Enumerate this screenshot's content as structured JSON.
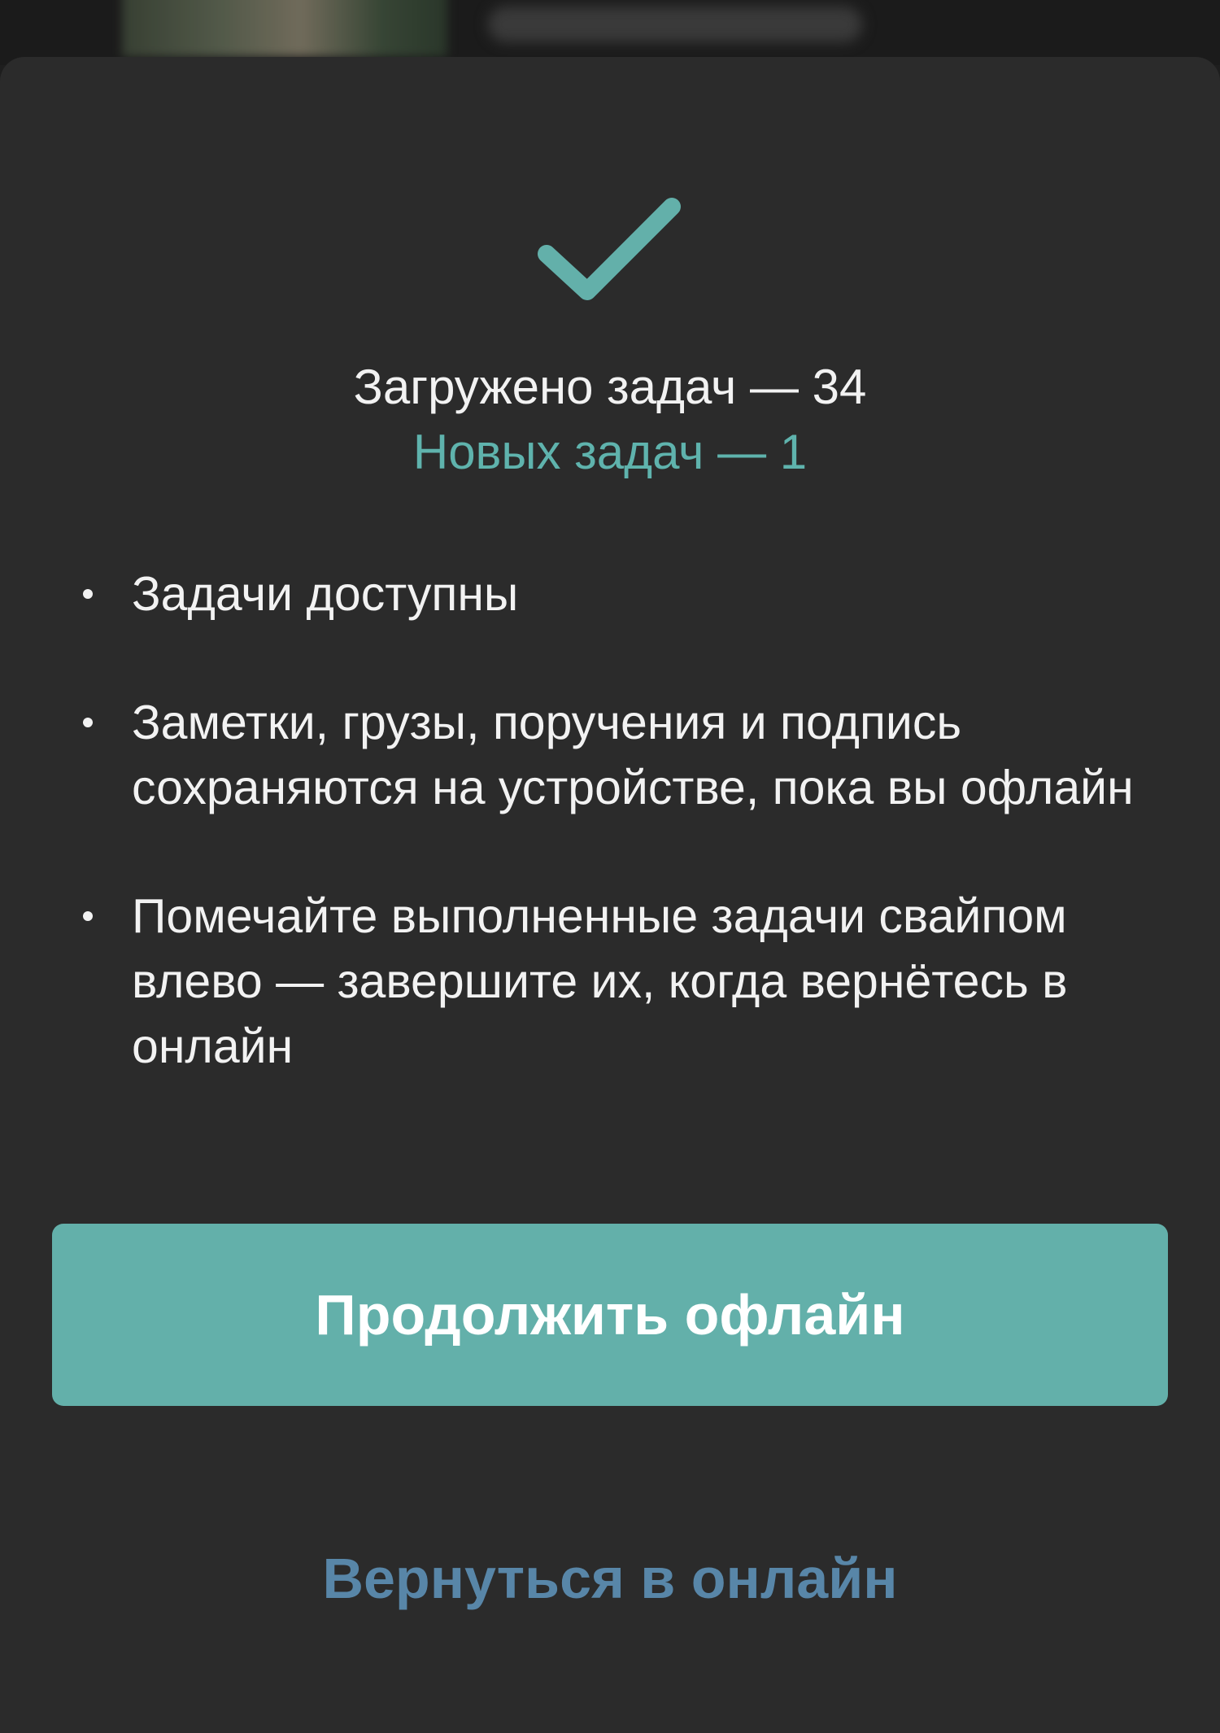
{
  "dialog": {
    "icon": "checkmark-icon",
    "accent_color": "#63b0aa",
    "loaded_text": "Загружено задач — 34",
    "new_text": "Новых задач — 1",
    "bullets": [
      "Задачи доступны",
      "Заметки, грузы, поручения и подпись сохраняются на устройстве, пока вы офлайн",
      "Помечайте выполненные задачи свайпом влево — завершите их, когда вернётесь в онлайн"
    ],
    "primary_button": "Продолжить офлайн",
    "secondary_link": "Вернуться в онлайн",
    "secondary_color": "#5886a8"
  }
}
